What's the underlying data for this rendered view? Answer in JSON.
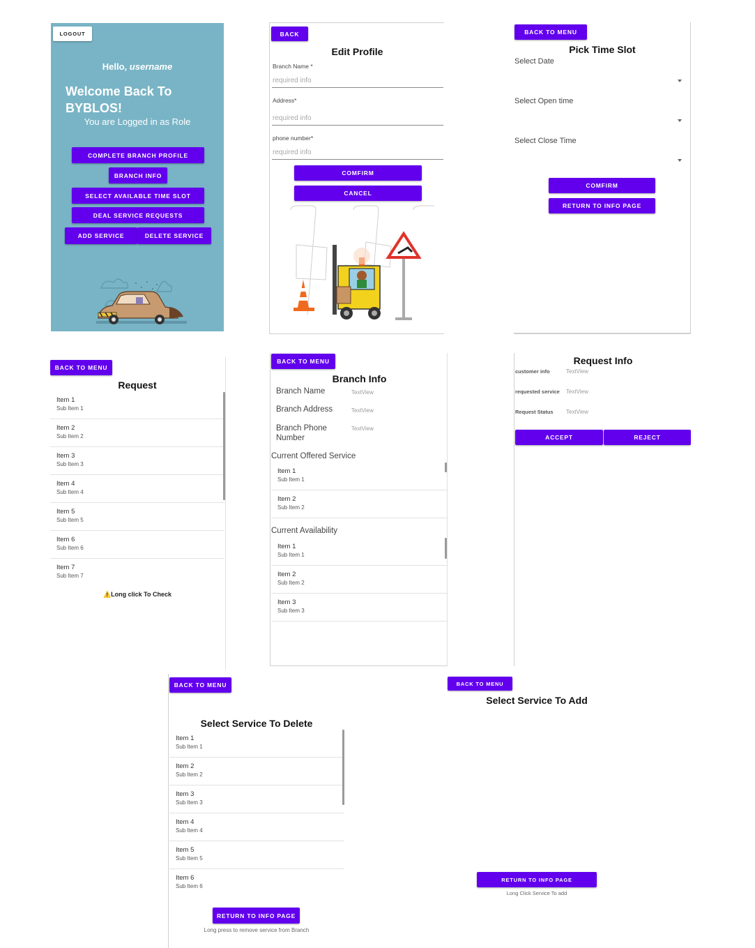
{
  "home": {
    "logout": "LOGOUT",
    "hello_prefix": "Hello,",
    "hello_user": "username",
    "welcome": "Welcome Back To BYBLOS!",
    "role_text": "You are Logged in as Role",
    "buttons": [
      "COMPLETE BRANCH PROFILE",
      "BRANCH INFO",
      "SELECT AVAILABLE TIME SLOT",
      "DEAL SERVICE REQUESTS",
      "ADD SERVICE",
      "DELETE SERVICE"
    ],
    "bg_color": "#78b4c6"
  },
  "edit_profile": {
    "back": "BACK",
    "title": "Edit Profile",
    "fields": [
      {
        "label": "Branch Name *",
        "placeholder": "required info"
      },
      {
        "label": "Address*",
        "placeholder": "required info"
      },
      {
        "label": "phone number*",
        "placeholder": "required info"
      }
    ],
    "confirm": "COMFIRM",
    "cancel": "CANCEL"
  },
  "time_slot": {
    "back": "BACK TO MENU",
    "title": "Pick Time Slot",
    "labels": [
      "Select Date",
      "Select Open time",
      "Select Close Time"
    ],
    "confirm": "COMFIRM",
    "return": "RETURN TO INFO PAGE"
  },
  "request": {
    "back": "BACK TO MENU",
    "title": "Request",
    "items": [
      {
        "t": "Item 1",
        "s": "Sub Item 1"
      },
      {
        "t": "Item 2",
        "s": "Sub Item 2"
      },
      {
        "t": "Item 3",
        "s": "Sub Item 3"
      },
      {
        "t": "Item 4",
        "s": "Sub Item 4"
      },
      {
        "t": "Item 5",
        "s": "Sub Item 5"
      },
      {
        "t": "Item 6",
        "s": "Sub Item 6"
      },
      {
        "t": "Item 7",
        "s": "Sub Item 7"
      }
    ],
    "hint_icon": "⚠️",
    "hint": "Long click To Check"
  },
  "branch_info": {
    "back": "BACK TO MENU",
    "title": "Branch Info",
    "name_label": "Branch Name",
    "address_label": "Branch Address",
    "phone_label_1": "Branch Phone",
    "phone_label_2": "Number",
    "textview": "TextView",
    "offered_heading": "Current Offered Service",
    "offered": [
      {
        "t": "Item 1",
        "s": "Sub Item 1"
      },
      {
        "t": "Item 2",
        "s": "Sub Item 2"
      }
    ],
    "availability_heading": "Current Availability",
    "availability": [
      {
        "t": "Item 1",
        "s": "Sub Item 1"
      },
      {
        "t": "Item 2",
        "s": "Sub Item 2"
      },
      {
        "t": "Item 3",
        "s": "Sub Item 3"
      }
    ]
  },
  "request_info": {
    "title": "Request Info",
    "labels": [
      "customer info",
      "requested service",
      "Request Status"
    ],
    "textview": "TextView",
    "accept": "ACCEPT",
    "reject": "REJECT"
  },
  "delete_service": {
    "back": "BACK TO MENU",
    "title": "Select Service To Delete",
    "items": [
      {
        "t": "Item 1",
        "s": "Sub Item 1"
      },
      {
        "t": "Item 2",
        "s": "Sub Item 2"
      },
      {
        "t": "Item 3",
        "s": "Sub Item 3"
      },
      {
        "t": "Item 4",
        "s": "Sub Item 4"
      },
      {
        "t": "Item 5",
        "s": "Sub Item 5"
      },
      {
        "t": "Item 6",
        "s": "Sub Item 6"
      }
    ],
    "return": "RETURN TO INFO PAGE",
    "hint": "Long press to remove service from Branch"
  },
  "add_service": {
    "back": "BACK TO MENU",
    "title": "Select Service To Add",
    "return": "RETURN TO INFO PAGE",
    "hint": "Long Click Service To add"
  },
  "colors": {
    "accent": "#6200ee"
  }
}
